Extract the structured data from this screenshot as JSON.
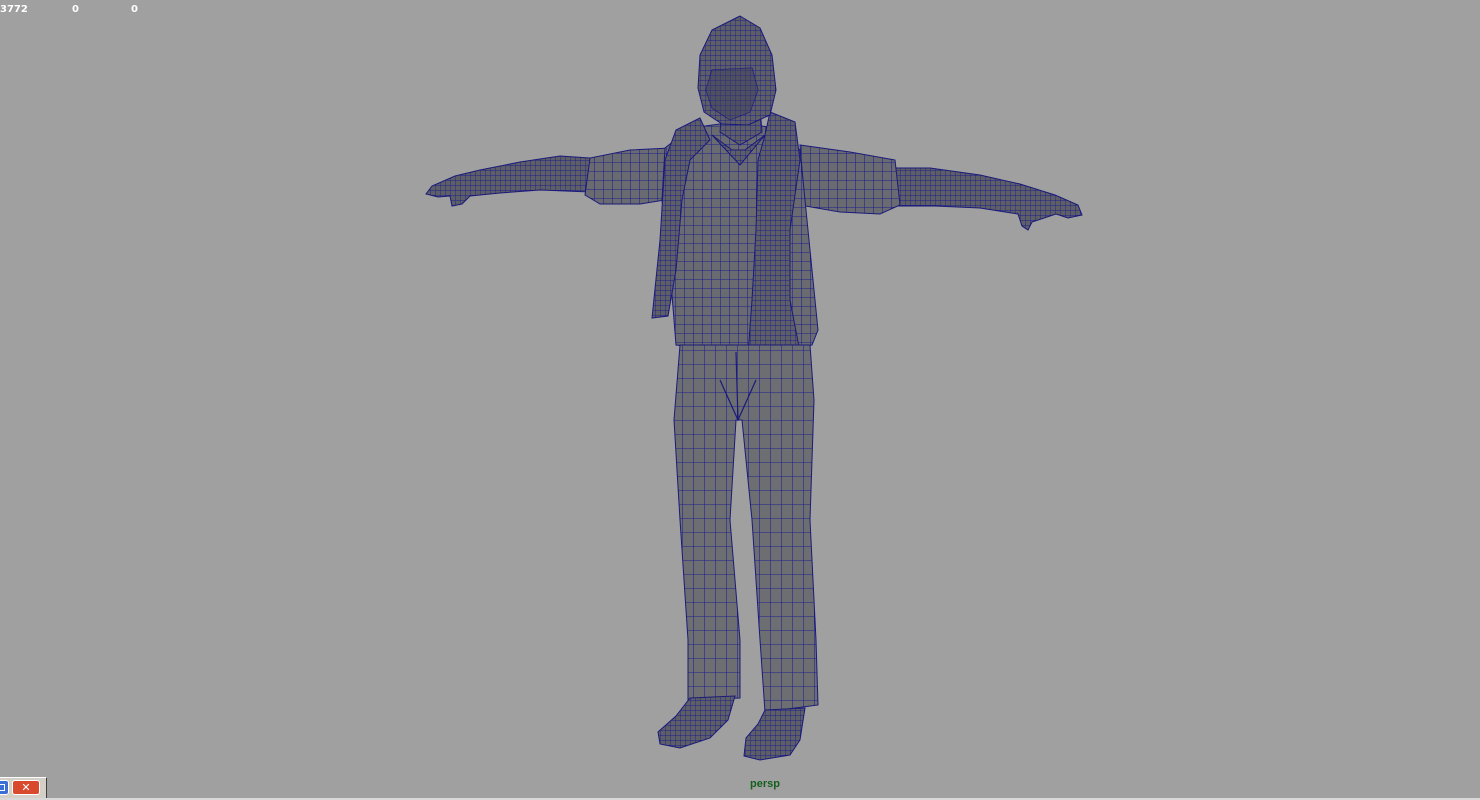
{
  "hud": {
    "values": [
      "3772",
      "0",
      "0"
    ]
  },
  "viewport": {
    "camera": "persp",
    "background": "#a0a0a0",
    "mesh_fill": "#6b6b6e",
    "wire_color": "#1a1a8c"
  },
  "window_controls": {
    "restore_icon": "restore-icon",
    "close_icon": "close-icon",
    "close_glyph": "✕"
  }
}
